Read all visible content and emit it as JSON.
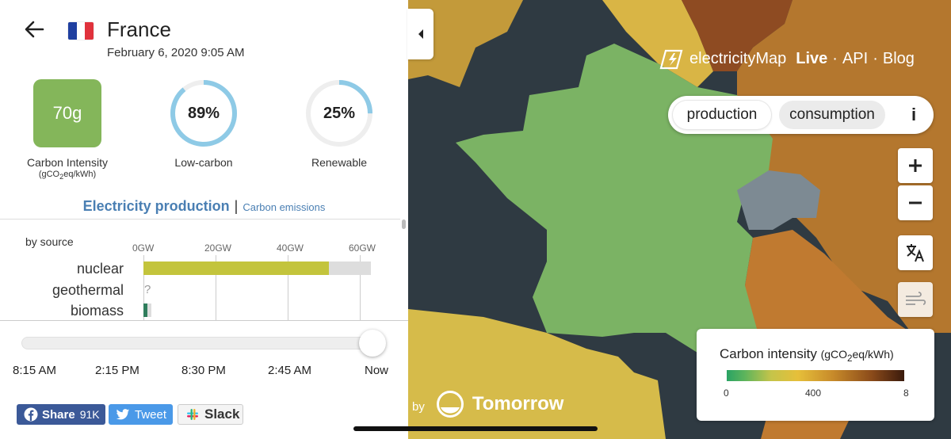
{
  "header": {
    "country": "France",
    "datetime": "February 6, 2020 9:05 AM"
  },
  "flag_colors": [
    "#1f3fa0",
    "#ffffff",
    "#e0323c"
  ],
  "metrics": {
    "carbon_intensity": {
      "value": "70g",
      "label": "Carbon Intensity",
      "unit_prefix": "(gCO",
      "unit_sub": "2",
      "unit_suffix": "eq/kWh)",
      "color": "#84b65a"
    },
    "low_carbon": {
      "value": "89%",
      "fraction": 0.89,
      "label": "Low-carbon",
      "color": "#8ecae6"
    },
    "renewable": {
      "value": "25%",
      "fraction": 0.25,
      "label": "Renewable",
      "color": "#8ecae6"
    }
  },
  "tabs": {
    "active": "Electricity production",
    "separator": "|",
    "other": "Carbon emissions"
  },
  "chart_data": {
    "type": "bar",
    "title": "by source",
    "x_ticks": [
      "0GW",
      "20GW",
      "40GW",
      "60GW"
    ],
    "xlim": [
      0,
      63
    ],
    "rows": [
      {
        "label": "nuclear",
        "value": 51.5,
        "capacity": 63,
        "color": "#c3c43c"
      },
      {
        "label": "geothermal",
        "value": null,
        "missing_symbol": "?"
      },
      {
        "label": "biomass",
        "value": 1.2,
        "capacity": 2.2,
        "color": "#2f7d5c"
      }
    ]
  },
  "timeline": {
    "labels": [
      "8:15 AM",
      "2:15 PM",
      "8:30 PM",
      "2:45 AM",
      "Now"
    ],
    "position": 1.0
  },
  "share": {
    "facebook": {
      "label": "Share",
      "count": "91K"
    },
    "twitter": {
      "label": "Tweet"
    },
    "slack": {
      "label": "Slack"
    }
  },
  "brand": {
    "name": "electricityMap",
    "live": "Live",
    "api": "API",
    "blog": "Blog",
    "sep": "·"
  },
  "mode_toggle": {
    "production": "production",
    "consumption": "consumption",
    "info": "i",
    "selected": "production"
  },
  "legend": {
    "title": "Carbon intensity",
    "unit_prefix": "(gCO",
    "unit_sub": "2",
    "unit_suffix": "eq/kWh)",
    "ticks": [
      "0",
      "400",
      "8"
    ]
  },
  "sponsor": {
    "by": "by",
    "name": "Tomorrow"
  },
  "map_colors": {
    "ocean": "#2f3a42",
    "france": "#7bb364",
    "spain": "#d6bb4a",
    "uk": "#c39a3a",
    "germany": "#b4772e",
    "switzerland": "#7d8a93",
    "italy": "#c07a30",
    "belgium": "#d9b545",
    "north_east": "#8e4b22"
  }
}
